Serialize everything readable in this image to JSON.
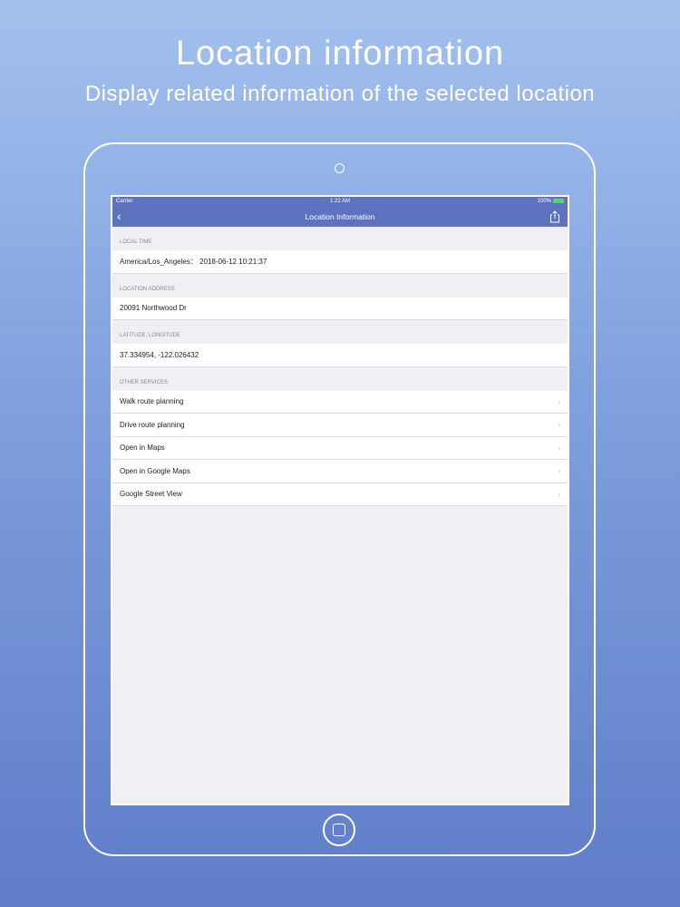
{
  "hero": {
    "title": "Location information",
    "subtitle": "Display related information of the selected location"
  },
  "status_bar": {
    "carrier": "Carrier",
    "time": "1:22 AM",
    "battery": "100%"
  },
  "nav": {
    "title": "Location Information",
    "back_icon": "chevron-left-icon",
    "share_icon": "share-icon"
  },
  "sections": {
    "local_time": {
      "header": "LOCAL TIME",
      "value": "America/Los_Angeles： 2018-06-12 10:21:37"
    },
    "address": {
      "header": "LOCATION ADDRESS",
      "value": "20091 Northwood Dr"
    },
    "coords": {
      "header": "LATITUDE, LONGITUDE",
      "value": "37.334954, -122.026432"
    },
    "services": {
      "header": "OTHER SERVICES",
      "items": [
        {
          "label": "Walk route planning"
        },
        {
          "label": "Drive route planning"
        },
        {
          "label": "Open in Maps"
        },
        {
          "label": "Open in Google Maps"
        },
        {
          "label": "Google Street View"
        }
      ]
    }
  },
  "colors": {
    "nav_bar": "#5f72c0",
    "background": "#efeff4",
    "chevron": "#c7c7cc"
  }
}
